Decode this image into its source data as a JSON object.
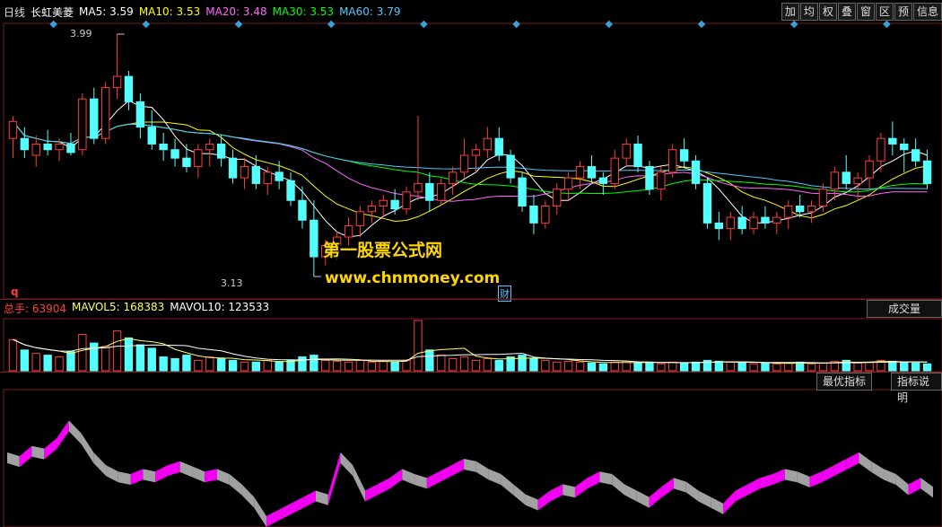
{
  "header": {
    "period": "日线",
    "stock_name": "长虹美菱",
    "ma": [
      {
        "label": "MA5: 3.59",
        "color": "#ffffff"
      },
      {
        "label": "MA10: 3.53",
        "color": "#ffff00"
      },
      {
        "label": "MA20: 3.48",
        "color": "#ff66ff"
      },
      {
        "label": "MA30: 3.53",
        "color": "#00ff00"
      },
      {
        "label": "MA60: 3.79",
        "color": "#4fc8ff"
      }
    ]
  },
  "toolbar": [
    "加",
    "均",
    "权",
    "叠",
    "窗",
    "区",
    "预",
    "信息"
  ],
  "annotations": {
    "high": "3.99",
    "low": "3.13",
    "q_marker": "q",
    "cai_marker": "财"
  },
  "watermark": {
    "line1": "第一股票公式网",
    "line2": "www.chnmoney.com"
  },
  "volume": {
    "labels": [
      {
        "text": "总手: 63904",
        "color": "#ff4040"
      },
      {
        "text": "MAVOL5: 168383",
        "color": "#ffff66"
      },
      {
        "text": "MAVOL10: 123533",
        "color": "#ffffff"
      }
    ],
    "dropdown": "成交量"
  },
  "indicator": {
    "optimal_button": "最优指标",
    "help_button": "指标说明"
  },
  "colors": {
    "up": "#ff3c3c",
    "down": "#54ffff",
    "border": "#7a1d1d",
    "ind_pos": "#ff00ff",
    "ind_neg": "#aaaaaa"
  },
  "chart_data": {
    "type": "candlestick",
    "y_range": [
      3.13,
      3.99
    ],
    "marker_count": 10,
    "ohlc": [
      [
        3.62,
        3.7,
        3.55,
        3.68
      ],
      [
        3.62,
        3.66,
        3.55,
        3.58
      ],
      [
        3.56,
        3.63,
        3.52,
        3.6
      ],
      [
        3.6,
        3.65,
        3.56,
        3.58
      ],
      [
        3.58,
        3.62,
        3.54,
        3.6
      ],
      [
        3.6,
        3.64,
        3.56,
        3.57
      ],
      [
        3.58,
        3.78,
        3.56,
        3.76
      ],
      [
        3.76,
        3.8,
        3.6,
        3.62
      ],
      [
        3.62,
        3.82,
        3.6,
        3.8
      ],
      [
        3.8,
        3.99,
        3.76,
        3.84
      ],
      [
        3.84,
        3.86,
        3.72,
        3.75
      ],
      [
        3.75,
        3.78,
        3.62,
        3.66
      ],
      [
        3.66,
        3.72,
        3.58,
        3.6
      ],
      [
        3.6,
        3.64,
        3.54,
        3.58
      ],
      [
        3.58,
        3.62,
        3.52,
        3.55
      ],
      [
        3.55,
        3.6,
        3.5,
        3.52
      ],
      [
        3.52,
        3.6,
        3.48,
        3.58
      ],
      [
        3.58,
        3.62,
        3.52,
        3.6
      ],
      [
        3.6,
        3.63,
        3.52,
        3.55
      ],
      [
        3.55,
        3.58,
        3.46,
        3.48
      ],
      [
        3.48,
        3.55,
        3.44,
        3.52
      ],
      [
        3.52,
        3.56,
        3.44,
        3.46
      ],
      [
        3.46,
        3.52,
        3.42,
        3.5
      ],
      [
        3.5,
        3.54,
        3.44,
        3.47
      ],
      [
        3.47,
        3.5,
        3.38,
        3.4
      ],
      [
        3.4,
        3.45,
        3.3,
        3.33
      ],
      [
        3.33,
        3.4,
        3.13,
        3.2
      ],
      [
        3.2,
        3.26,
        3.17,
        3.24
      ],
      [
        3.24,
        3.29,
        3.19,
        3.27
      ],
      [
        3.27,
        3.34,
        3.24,
        3.31
      ],
      [
        3.31,
        3.38,
        3.27,
        3.36
      ],
      [
        3.36,
        3.4,
        3.32,
        3.38
      ],
      [
        3.38,
        3.42,
        3.34,
        3.4
      ],
      [
        3.4,
        3.44,
        3.35,
        3.37
      ],
      [
        3.37,
        3.45,
        3.35,
        3.43
      ],
      [
        3.43,
        3.7,
        3.4,
        3.46
      ],
      [
        3.46,
        3.5,
        3.36,
        3.4
      ],
      [
        3.4,
        3.48,
        3.38,
        3.46
      ],
      [
        3.46,
        3.52,
        3.42,
        3.5
      ],
      [
        3.5,
        3.62,
        3.48,
        3.56
      ],
      [
        3.56,
        3.6,
        3.5,
        3.58
      ],
      [
        3.58,
        3.66,
        3.55,
        3.62
      ],
      [
        3.62,
        3.66,
        3.54,
        3.56
      ],
      [
        3.56,
        3.58,
        3.46,
        3.48
      ],
      [
        3.48,
        3.5,
        3.36,
        3.38
      ],
      [
        3.38,
        3.42,
        3.28,
        3.32
      ],
      [
        3.32,
        3.4,
        3.3,
        3.38
      ],
      [
        3.38,
        3.46,
        3.35,
        3.44
      ],
      [
        3.44,
        3.5,
        3.4,
        3.48
      ],
      [
        3.48,
        3.54,
        3.44,
        3.52
      ],
      [
        3.52,
        3.56,
        3.46,
        3.48
      ],
      [
        3.48,
        3.5,
        3.42,
        3.46
      ],
      [
        3.46,
        3.58,
        3.44,
        3.55
      ],
      [
        3.55,
        3.62,
        3.52,
        3.6
      ],
      [
        3.6,
        3.63,
        3.5,
        3.52
      ],
      [
        3.52,
        3.54,
        3.42,
        3.44
      ],
      [
        3.44,
        3.52,
        3.4,
        3.5
      ],
      [
        3.5,
        3.6,
        3.48,
        3.58
      ],
      [
        3.58,
        3.62,
        3.52,
        3.54
      ],
      [
        3.54,
        3.56,
        3.44,
        3.46
      ],
      [
        3.46,
        3.48,
        3.3,
        3.32
      ],
      [
        3.32,
        3.36,
        3.26,
        3.3
      ],
      [
        3.3,
        3.36,
        3.26,
        3.34
      ],
      [
        3.34,
        3.38,
        3.28,
        3.3
      ],
      [
        3.3,
        3.36,
        3.28,
        3.34
      ],
      [
        3.34,
        3.38,
        3.3,
        3.32
      ],
      [
        3.32,
        3.36,
        3.28,
        3.34
      ],
      [
        3.34,
        3.4,
        3.3,
        3.38
      ],
      [
        3.38,
        3.42,
        3.34,
        3.36
      ],
      [
        3.36,
        3.4,
        3.32,
        3.38
      ],
      [
        3.38,
        3.46,
        3.36,
        3.44
      ],
      [
        3.44,
        3.52,
        3.4,
        3.5
      ],
      [
        3.5,
        3.56,
        3.44,
        3.46
      ],
      [
        3.46,
        3.5,
        3.4,
        3.48
      ],
      [
        3.48,
        3.56,
        3.44,
        3.54
      ],
      [
        3.54,
        3.64,
        3.5,
        3.62
      ],
      [
        3.62,
        3.68,
        3.56,
        3.6
      ],
      [
        3.6,
        3.62,
        3.5,
        3.58
      ],
      [
        3.58,
        3.62,
        3.52,
        3.54
      ],
      [
        3.54,
        3.58,
        3.44,
        3.46
      ]
    ],
    "volume": [
      180,
      120,
      100,
      90,
      80,
      110,
      210,
      160,
      140,
      230,
      190,
      150,
      130,
      80,
      70,
      90,
      60,
      80,
      70,
      60,
      50,
      50,
      60,
      50,
      60,
      80,
      90,
      60,
      55,
      50,
      60,
      50,
      55,
      50,
      60,
      290,
      120,
      90,
      70,
      80,
      60,
      70,
      60,
      80,
      90,
      70,
      60,
      50,
      55,
      50,
      45,
      40,
      50,
      55,
      45,
      50,
      40,
      50,
      45,
      50,
      60,
      55,
      50,
      45,
      40,
      45,
      40,
      45,
      50,
      40,
      45,
      55,
      60,
      45,
      50,
      60,
      55,
      50,
      45,
      40
    ],
    "indicator": [
      0.55,
      0.52,
      0.6,
      0.58,
      0.66,
      0.8,
      0.7,
      0.55,
      0.45,
      0.4,
      0.38,
      0.42,
      0.4,
      0.45,
      0.48,
      0.44,
      0.4,
      0.42,
      0.38,
      0.3,
      0.2,
      0.05,
      0.1,
      0.15,
      0.2,
      0.25,
      0.22,
      0.55,
      0.45,
      0.25,
      0.3,
      0.35,
      0.42,
      0.38,
      0.35,
      0.4,
      0.45,
      0.5,
      0.48,
      0.42,
      0.38,
      0.3,
      0.22,
      0.18,
      0.25,
      0.3,
      0.28,
      0.35,
      0.4,
      0.38,
      0.3,
      0.25,
      0.2,
      0.28,
      0.35,
      0.32,
      0.25,
      0.2,
      0.15,
      0.25,
      0.3,
      0.35,
      0.38,
      0.42,
      0.4,
      0.36,
      0.4,
      0.45,
      0.5,
      0.55,
      0.48,
      0.42,
      0.38,
      0.3,
      0.35,
      0.28
    ]
  }
}
